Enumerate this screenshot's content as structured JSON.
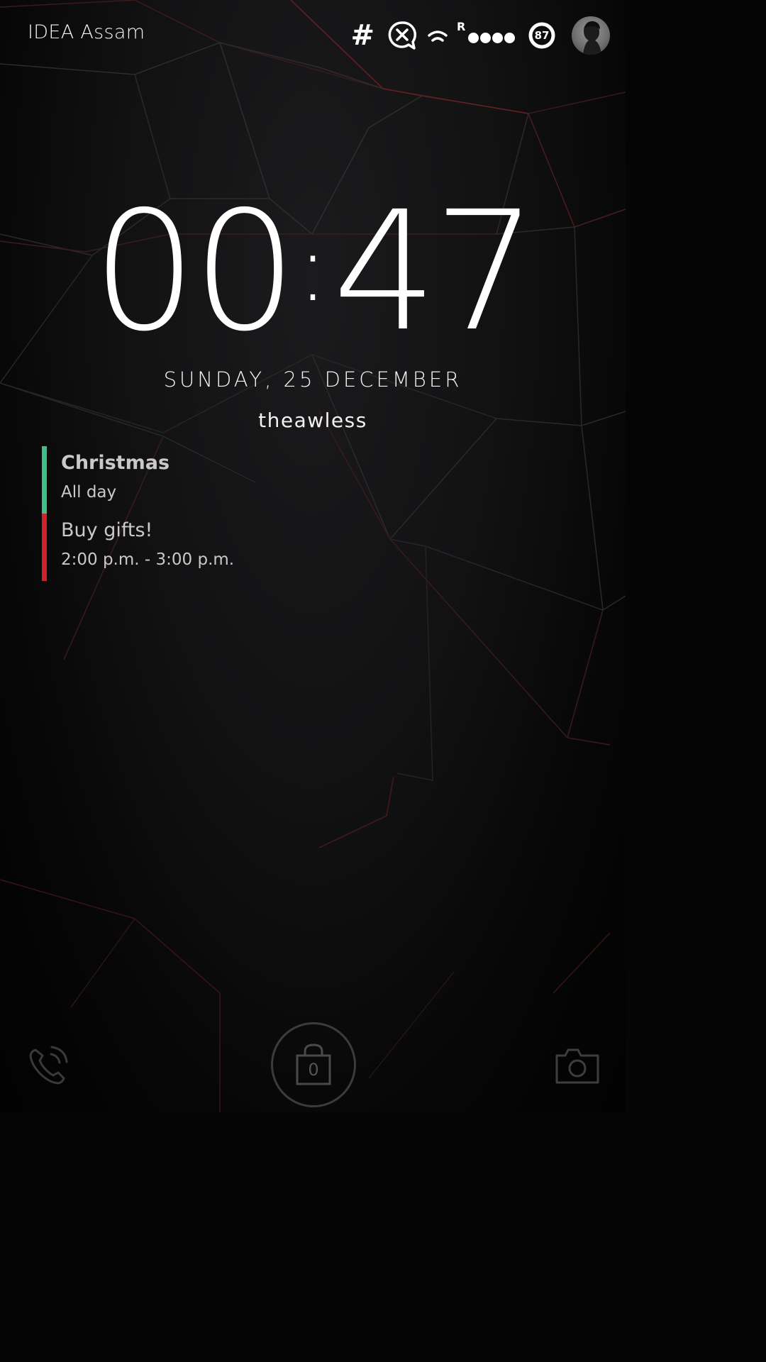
{
  "status_bar": {
    "carrier": "IDEA Assam",
    "hash_symbol": "#",
    "roaming_indicator": "R",
    "signal_bars": 4,
    "battery_percent": "87",
    "icons": [
      "hash-icon",
      "no-messages-icon",
      "wifi-icon",
      "signal-icon",
      "battery-icon",
      "avatar"
    ]
  },
  "clock": {
    "hours": "00",
    "minutes": "47"
  },
  "date": "SUNDAY, 25 DECEMBER",
  "owner": "theawless",
  "events": [
    {
      "title": "Christmas",
      "time": "All day",
      "color": "#3fbf85"
    },
    {
      "title": "Buy gifts!",
      "time": "2:00 p.m. - 3:00 p.m.",
      "color": "#d1222b"
    }
  ],
  "bottom": {
    "unlock_count": "0",
    "icons": [
      "phone-icon",
      "lock-icon",
      "camera-icon"
    ]
  }
}
